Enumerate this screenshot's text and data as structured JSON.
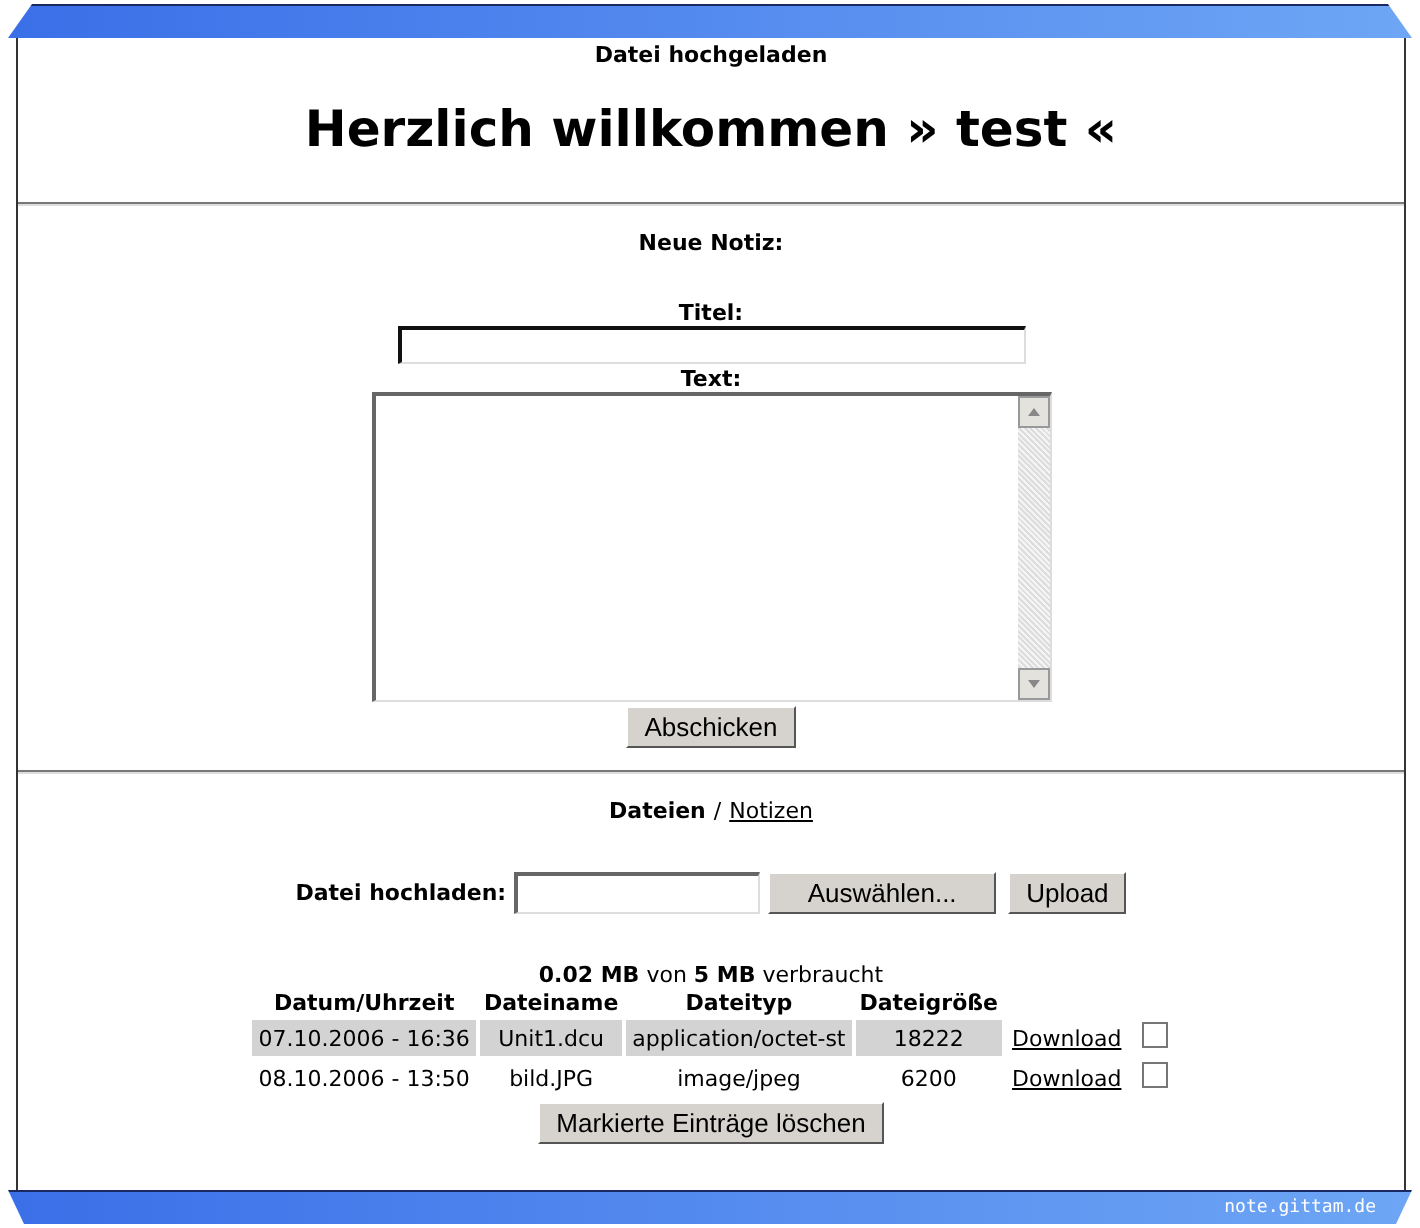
{
  "status_message": "Datei hochgeladen",
  "heading": "Herzlich willkommen » test «",
  "note_form": {
    "title": "Neue Notiz:",
    "title_label": "Titel:",
    "text_label": "Text:",
    "submit": "Abschicken"
  },
  "nav": {
    "separator": "/",
    "items": [
      {
        "label": "Dateien",
        "selected": true
      },
      {
        "label": "Notizen",
        "selected": false
      }
    ]
  },
  "upload": {
    "label": "Datei hochladen:",
    "browse": "Auswählen...",
    "submit": "Upload"
  },
  "usage": "**0.02 MB** von **5 MB** verbraucht",
  "table": {
    "columns": [
      "Datum/Uhrzeit",
      "Dateiname",
      "Dateityp",
      "Dateigröße"
    ],
    "rows": [
      {
        "cells": [
          "07.10.2006 - 16:36",
          "Unit1.dcu",
          "application/octet-st",
          "18222"
        ],
        "link": "Download",
        "shaded": true,
        "checked": false
      },
      {
        "cells": [
          "08.10.2006 - 13:50",
          "bild.JPG",
          "image/jpeg",
          "6200"
        ],
        "link": "Download",
        "shaded": false,
        "checked": false
      }
    ]
  },
  "delete_button": "Markierte Einträge löschen",
  "footer": "note.gittam.de"
}
